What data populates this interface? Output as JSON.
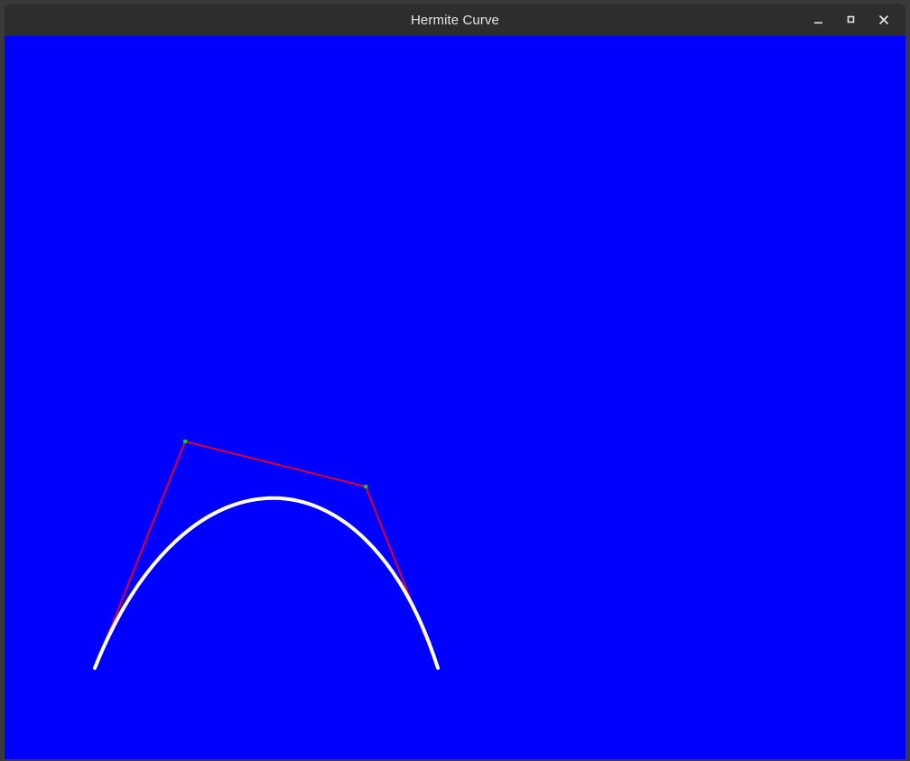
{
  "window": {
    "title": "Hermite Curve"
  },
  "icons": {
    "minimize": "minimize-icon",
    "maximize": "maximize-icon",
    "close": "close-icon"
  },
  "colors": {
    "background": "#0000ff",
    "curve": "#ffffff",
    "control_polygon": "#e0002a",
    "control_points": "#00d000",
    "titlebar": "#2d2d2d"
  }
}
